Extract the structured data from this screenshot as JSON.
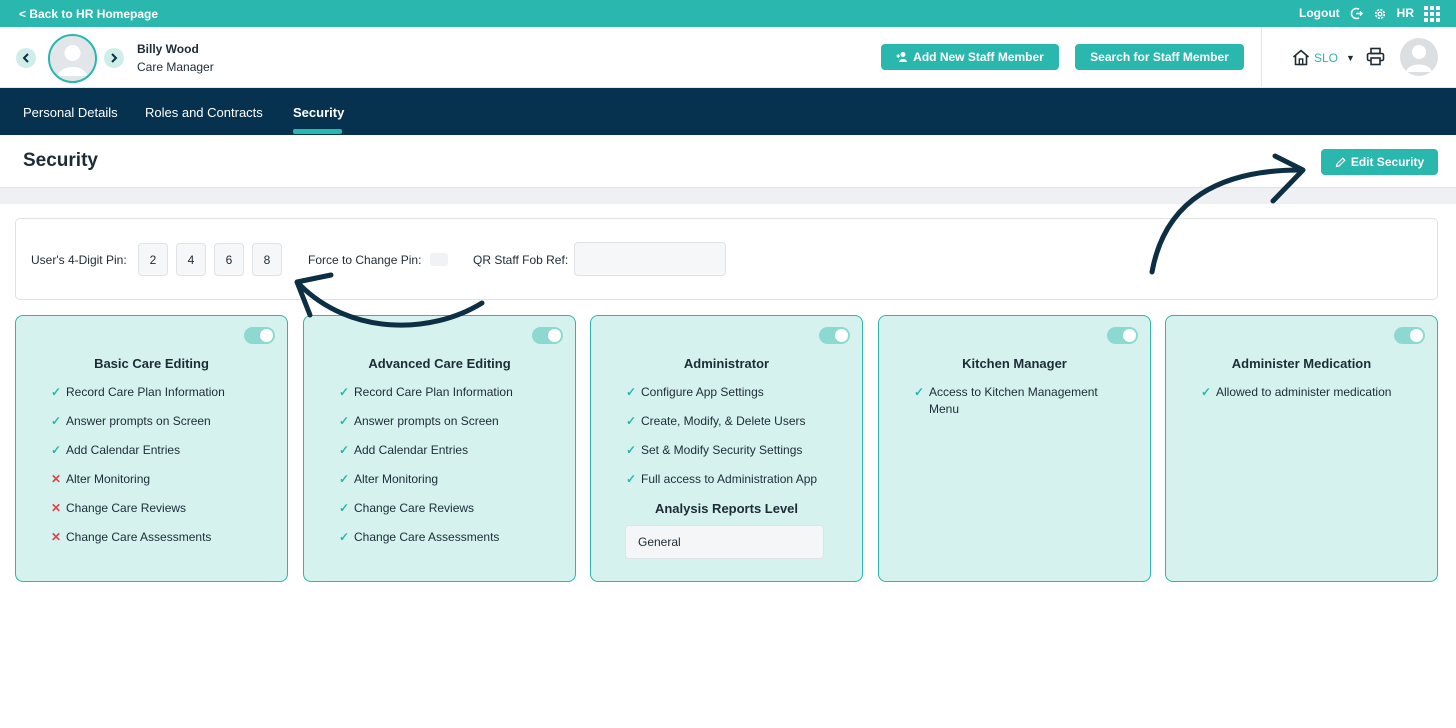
{
  "topbar": {
    "back_label": "< Back to HR Homepage",
    "logout_label": "Logout",
    "hr_label": "HR"
  },
  "header": {
    "staff_name": "Billy Wood",
    "staff_role": "Care Manager",
    "add_staff_label": "Add New Staff Member",
    "search_staff_label": "Search for Staff Member",
    "location_label": "SLO"
  },
  "tabs": [
    {
      "label": "Personal Details"
    },
    {
      "label": "Roles and Contracts"
    },
    {
      "label": "Security",
      "active": true
    }
  ],
  "page": {
    "title": "Security",
    "edit_label": "Edit Security"
  },
  "pin_panel": {
    "pin_label": "User's 4-Digit Pin:",
    "pin_digits": [
      "2",
      "4",
      "6",
      "8"
    ],
    "force_label": "Force to Change Pin:",
    "qr_label": "QR Staff Fob Ref:",
    "qr_value": ""
  },
  "cards": [
    {
      "title": "Basic Care Editing",
      "enabled": true,
      "permissions": [
        {
          "label": "Record Care Plan Information",
          "allowed": true
        },
        {
          "label": "Answer prompts on Screen",
          "allowed": true
        },
        {
          "label": "Add Calendar Entries",
          "allowed": true
        },
        {
          "label": "Alter Monitoring",
          "allowed": false
        },
        {
          "label": "Change Care Reviews",
          "allowed": false
        },
        {
          "label": "Change Care Assessments",
          "allowed": false
        }
      ]
    },
    {
      "title": "Advanced Care Editing",
      "enabled": true,
      "permissions": [
        {
          "label": "Record Care Plan Information",
          "allowed": true
        },
        {
          "label": "Answer prompts on Screen",
          "allowed": true
        },
        {
          "label": "Add Calendar Entries",
          "allowed": true
        },
        {
          "label": "Alter Monitoring",
          "allowed": true
        },
        {
          "label": "Change Care Reviews",
          "allowed": true
        },
        {
          "label": "Change Care Assessments",
          "allowed": true
        }
      ]
    },
    {
      "title": "Administrator",
      "enabled": true,
      "permissions": [
        {
          "label": "Configure App Settings",
          "allowed": true
        },
        {
          "label": "Create, Modify, & Delete Users",
          "allowed": true
        },
        {
          "label": "Set & Modify Security Settings",
          "allowed": true
        },
        {
          "label": "Full access to Administration App",
          "allowed": true
        }
      ],
      "reports_title": "Analysis Reports Level",
      "reports_value": "General"
    },
    {
      "title": "Kitchen Manager",
      "enabled": true,
      "permissions": [
        {
          "label": "Access to Kitchen Management Menu",
          "allowed": true
        }
      ]
    },
    {
      "title": "Administer Medication",
      "enabled": true,
      "permissions": [
        {
          "label": "Allowed to administer medication",
          "allowed": true
        }
      ]
    }
  ],
  "icons": {
    "check": "check-icon",
    "cross": "cross-icon",
    "logout": "logout-icon",
    "settings": "gear-icon",
    "apps": "grid-icon",
    "home": "home-icon",
    "print": "printer-icon",
    "edit": "pencil-icon"
  },
  "colors": {
    "accent": "#2ab7ad",
    "navy": "#06324f",
    "card_bg": "#d6f2ef",
    "deny": "#e0434b"
  }
}
